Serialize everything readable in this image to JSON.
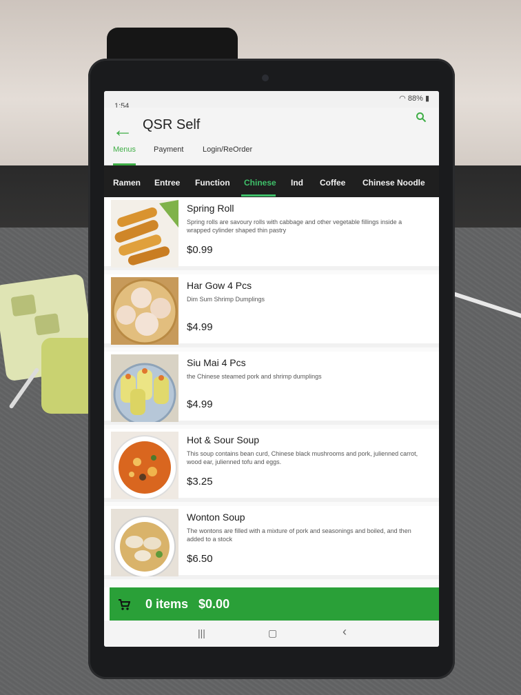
{
  "status_bar": {
    "time": "1:54",
    "battery": "88%"
  },
  "app": {
    "title": "QSR Self"
  },
  "tabs": [
    {
      "label": "Menus"
    },
    {
      "label": "Payment"
    },
    {
      "label": "Login/ReOrder"
    }
  ],
  "categories": [
    {
      "label": "Ramen"
    },
    {
      "label": "Entree"
    },
    {
      "label": "Function"
    },
    {
      "label": "Chinese"
    },
    {
      "label": "Ind"
    },
    {
      "label": "Coffee"
    },
    {
      "label": "Chinese Noodle"
    }
  ],
  "items": [
    {
      "name": "Spring Roll",
      "description": "Spring rolls are savoury rolls with cabbage and other vegetable fillings inside a wrapped cylinder shaped thin pastry",
      "price": "$0.99"
    },
    {
      "name": "Har Gow 4 Pcs",
      "description": "Dim Sum Shrimp Dumplings",
      "price": "$4.99"
    },
    {
      "name": "Siu Mai 4 Pcs",
      "description": "the Chinese steamed pork and shrimp dumplings",
      "price": "$4.99"
    },
    {
      "name": "Hot & Sour Soup",
      "description": "This soup contains bean curd, Chinese black mushrooms and  pork, julienned carrot, wood ear, julienned tofu and eggs.",
      "price": "$3.25"
    },
    {
      "name": "Wonton Soup",
      "description": "The wontons are filled with a mixture of pork and seasonings and boiled, and then added to a stock",
      "price": "$6.50"
    }
  ],
  "cart": {
    "summary": "0 items   $0.00"
  },
  "nav_bar": {
    "recents": "|||",
    "home": "▢",
    "back": "‹"
  },
  "colors": {
    "accent": "#3fae46",
    "cart_bar": "#2aa038",
    "category_bar": "#1f1f1f"
  }
}
